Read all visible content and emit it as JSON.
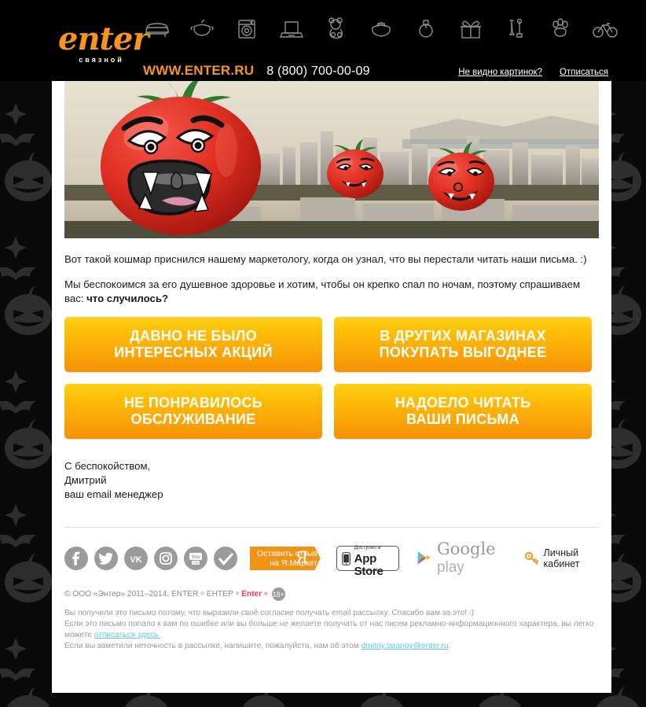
{
  "header": {
    "logo_word": "enter",
    "logo_sub": "связной",
    "site_url": "WWW.ENTER.RU",
    "phone": "8 (800) 700-00-09",
    "links": [
      {
        "label": "Не видно картинок?",
        "name": "images-not-visible-link"
      },
      {
        "label": "Отписаться",
        "name": "unsubscribe-link"
      }
    ],
    "category_icons": [
      "sofa-icon",
      "pot-icon",
      "washing-machine-icon",
      "laptop-icon",
      "teddy-bear-icon",
      "purse-icon",
      "perfume-icon",
      "gift-icon",
      "garden-tools-icon",
      "paw-print-icon",
      "bicycle-icon"
    ]
  },
  "hero": {
    "alt": "angry-cartoon-tomatoes-over-city-skyline"
  },
  "body": {
    "paragraph1": "Вот такой кошмар приснился нашему маркетологу, когда он узнал, что вы перестали читать наши письма. :)",
    "paragraph2_prefix": "Мы беспокоимся за его душевное здоровье и хотим, чтобы он крепко спал по ночам, поэтому спрашиваем вас: ",
    "paragraph2_bold": "что случилось?"
  },
  "buttons": [
    {
      "line1": "ДАВНО НЕ БЫЛО",
      "line2": "ИНТЕРЕСНЫХ АКЦИЙ",
      "name": "cta-no-interesting-promos"
    },
    {
      "line1": "В ДРУГИХ МАГАЗИНАХ",
      "line2": "ПОКУПАТЬ ВЫГОДНЕЕ",
      "name": "cta-cheaper-elsewhere"
    },
    {
      "line1": "НЕ ПОНРАВИЛОСЬ",
      "line2": "ОБСЛУЖИВАНИЕ",
      "name": "cta-bad-service"
    },
    {
      "line1": "НАДОЕЛО ЧИТАТЬ",
      "line2": "ВАШИ ПИСЬМА",
      "name": "cta-tired-of-emails"
    }
  ],
  "signature": {
    "line1": "С беспокойством,",
    "line2": "Дмитрий",
    "line3": "ваш email менеджер"
  },
  "footer": {
    "social": [
      {
        "name": "facebook-icon",
        "glyph": "f"
      },
      {
        "name": "twitter-icon",
        "glyph": "t"
      },
      {
        "name": "vk-icon",
        "glyph": "vk"
      },
      {
        "name": "instagram-icon",
        "glyph": "ig"
      },
      {
        "name": "youtube-icon",
        "glyph": "yt"
      },
      {
        "name": "check-icon",
        "glyph": "check"
      }
    ],
    "yandex_badge": {
      "line1": "Оставить отзыв",
      "line2": "на Я.Маркет",
      "mark": "Я",
      "color": "#F29318"
    },
    "appstore": {
      "small": "Доступно в",
      "big": "App Store"
    },
    "googleplay": {
      "word1": "Google",
      "word2": "play"
    },
    "account": {
      "label": "Личный кабинет"
    }
  },
  "legal": {
    "copyright_prefix": "© ООО «Энтер» 2011–2014. ENTER",
    "copyright_mid": " ЕНТЕР",
    "brand_red": "Enter",
    "age_badge": "18+",
    "p1": "Вы получили это письмо потому, что выразили своё согласие получать email рассылку. Спасибо вам за это! :)",
    "p2_a": "Если это письмо попало к вам по ошибке или вы больше не желаете получать от нас писем рекламно-информационного характера, вы легко можете ",
    "p2_link": "отписаться здесь.",
    "p3_a": "Если вы заметили неточность в рассылке, напишите, пожалуйста, нам об этом ",
    "p3_link": "dmitriy.taranov@enter.ru",
    "p3_b": "."
  },
  "colors": {
    "brand_orange": "#F7941E",
    "button_top": "#FFD21A",
    "button_bottom": "#F79000",
    "link_blue": "#5BC8E8",
    "brand_red": "#E8414A"
  }
}
